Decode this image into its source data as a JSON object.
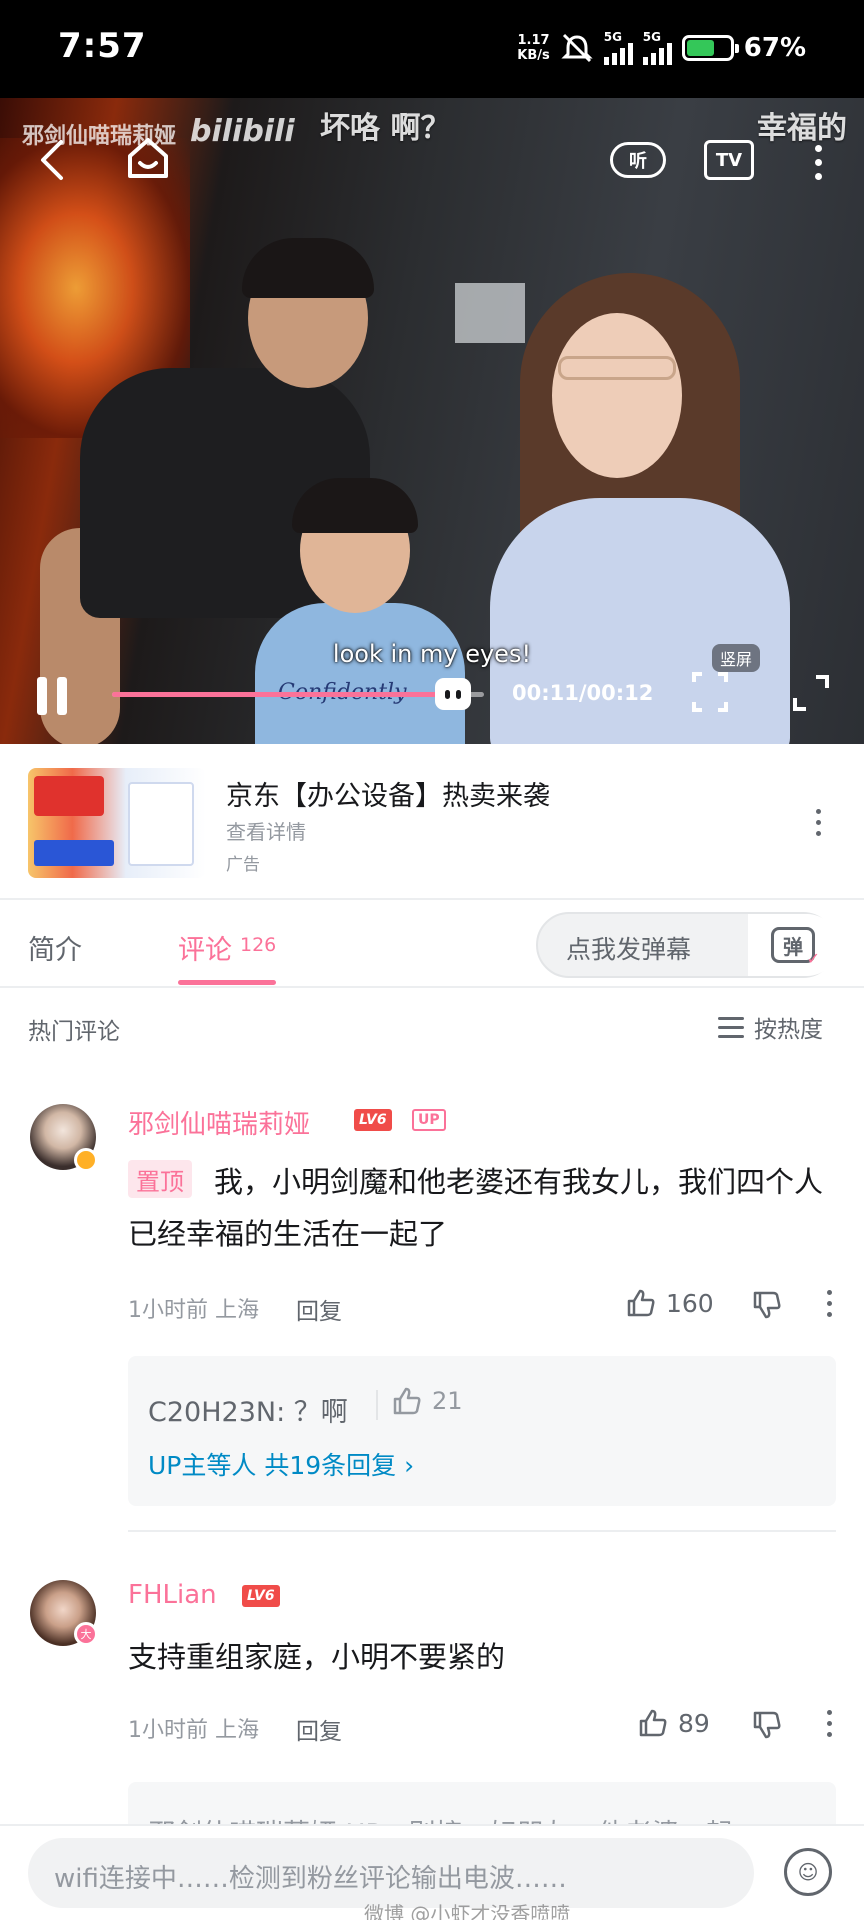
{
  "status_bar": {
    "time": "7:57",
    "net_speed_value": "1.17",
    "net_speed_unit": "KB/s",
    "sim1": "5G",
    "sim2": "5G",
    "battery_percent": "67%"
  },
  "video": {
    "watermark_user": "邪剑仙喵瑞莉娅",
    "watermark_logo": "bilibili",
    "danmaku": [
      "坏咯  啊？",
      "幸福的"
    ],
    "shirt_text": "Confidently",
    "subtitle": "look in my eyes!",
    "listen_label": "听",
    "tv_label": "TV",
    "vertical_label": "竖屏",
    "current_time": "00:11",
    "duration": "00:12",
    "time_display": "00:11/00:12",
    "progress": 0.917
  },
  "ad": {
    "title": "京东【办公设备】热卖来袭",
    "subtitle": "查看详情",
    "label": "广告"
  },
  "tabs": {
    "intro": "简介",
    "comments": "评论",
    "comments_count": "126",
    "danmaku_placeholder": "点我发弹幕",
    "danmaku_icon_label": "弹"
  },
  "comments_header": {
    "hot": "热门评论",
    "sort": "按热度"
  },
  "comments": [
    {
      "username": "邪剑仙喵瑞莉娅",
      "level": "LV6",
      "up_tag": "UP",
      "pinned_tag": "置顶",
      "text": "我，小明剑魔和他老婆还有我女儿，我们四个人已经幸福的生活在一起了",
      "time_location": "1小时前  上海",
      "reply_label": "回复",
      "likes": "160",
      "reply_preview": {
        "text": "C20H23N: ？啊",
        "likes": "21",
        "more": "UP主等人 共19条回复 ›"
      }
    },
    {
      "username": "FHLian",
      "level": "LV6",
      "avatar_badge": "大",
      "text": "支持重组家庭，小明不要紧的",
      "time_location": "1小时前  上海",
      "reply_label": "回复",
      "likes": "89",
      "reply_preview": {
        "text": "邪剑仙喵瑞莉娅 UP：别接，好朋友，他老婆一起"
      }
    }
  ],
  "bottom_bar": {
    "placeholder": "wifi连接中……检测到粉丝评论输出电波……",
    "emoji_icon_label": "☺",
    "weibo_watermark": "微博 @小虾才没香喷喷"
  },
  "colors": {
    "brand_pink": "#fb7299",
    "level_red": "#f04c49",
    "link_blue": "#008ac5",
    "text_primary": "#18191c",
    "text_secondary": "#61666d",
    "text_tertiary": "#9499a0"
  }
}
